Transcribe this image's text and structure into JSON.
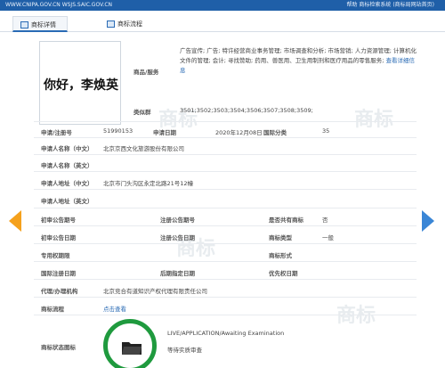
{
  "topbar": {
    "site": "WWW.CNIPA.GOV.CN  WSJS.SAIC.GOV.CN",
    "tools": "帮助   商标检索系统   (商标局网站首页)"
  },
  "tabs": [
    {
      "label": "商标详情",
      "active": true
    },
    {
      "label": "商标流程",
      "active": false
    }
  ],
  "trademark": {
    "image_text": "你好，李焕英",
    "services_label": "商品/服务",
    "services_text": "广告宣传; 广告; 特许经营商业事务管理; 市场调查和分析; 市场营销; 人力资源管理; 计算机化文件的管理; 会计; 寻找赞助; 药用、兽医用、卫生用制剂和医疗用品的零售服务;",
    "services_link": "查看详细信息",
    "similar_group_label": "类似群",
    "similar_group_value": "3501;3502;3503;3504;3506;3507;3508;3509;"
  },
  "fields": {
    "reg_no_label": "申请/注册号",
    "reg_no": "51990153",
    "app_date_label": "申请日期",
    "app_date": "2020年12月08日",
    "intl_class_label": "国际分类",
    "intl_class": "35",
    "applicant_cn_label": "申请人名称（中文）",
    "applicant_cn": "北京京西文化旅游股份有限公司",
    "applicant_en_label": "申请人名称（英文）",
    "applicant_en": "",
    "address_cn_label": "申请人地址（中文）",
    "address_cn": "北京市门头沟区永定北路21号12幢",
    "address_en_label": "申请人地址（英文）",
    "address_en": "",
    "prelim_issue_label": "初审公告期号",
    "prelim_issue": "",
    "reg_issue_label": "注册公告期号",
    "reg_issue": "",
    "shared_label": "是否共有商标",
    "shared": "否",
    "prelim_date_label": "初审公告日期",
    "prelim_date": "",
    "reg_date_label": "注册公告日期",
    "reg_date": "",
    "mark_type_label": "商标类型",
    "mark_type": "一般",
    "exclusive_label": "专用权期限",
    "exclusive": "",
    "mark_form_label": "商标形式",
    "mark_form": "",
    "intl_reg_label": "国际注册日期",
    "intl_reg": "",
    "later_date_label": "后期指定日期",
    "later_date": "",
    "priority_label": "优先权日期",
    "priority": "",
    "agent_label": "代理/办理机构",
    "agent": "北京竞合有道知识产权代理有限责任公司",
    "process_label": "商标流程",
    "process_link": "点击查看",
    "status_icon_label": "商标状态图标",
    "status_line1": "LIVE/APPLICATION/Awaiting Examination",
    "status_line2": "等待实质审查"
  },
  "watermark_text": "商标",
  "colors": {
    "topbar": "#1f5fa8",
    "link": "#2a6bb5",
    "status_ring": "#1f9a3e",
    "prev_arrow": "#f5a11c",
    "next_arrow": "#3a86d6"
  }
}
